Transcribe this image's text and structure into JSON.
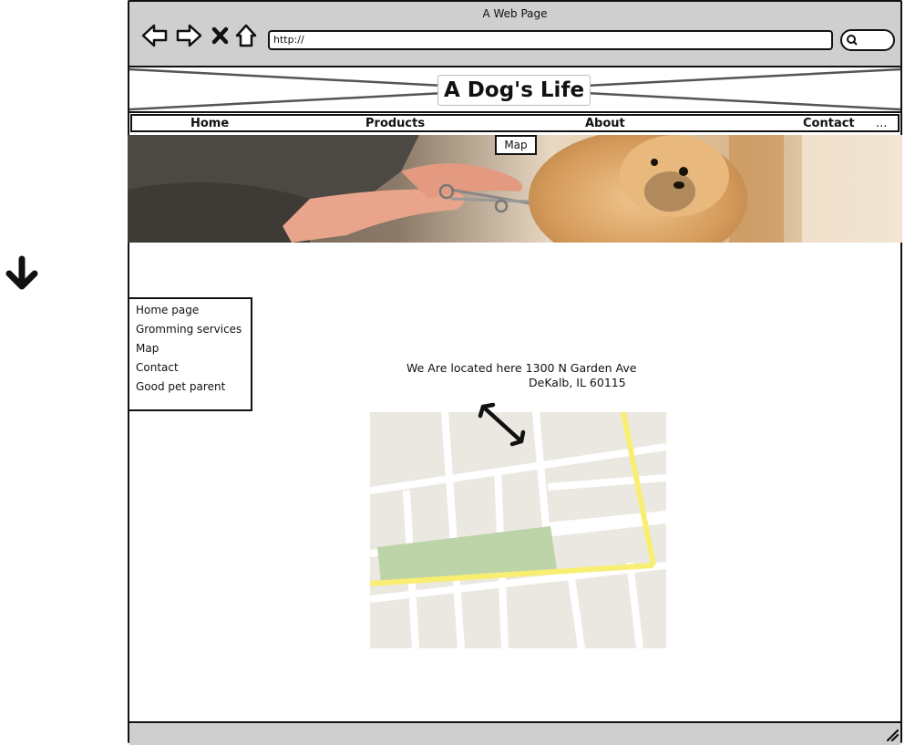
{
  "window": {
    "title": "A Web Page"
  },
  "browser": {
    "url": "http://",
    "nav_icons": [
      "back-icon",
      "forward-icon",
      "stop-icon",
      "home-icon"
    ],
    "search_icon": "search-icon"
  },
  "site": {
    "title": "A Dog's Life"
  },
  "navbar": {
    "items": [
      "Home",
      "Products",
      "About",
      "Contact"
    ],
    "more": "...",
    "dropdown": "Map"
  },
  "sidebar": {
    "items": [
      "Home page",
      "Gromming services",
      "Map",
      "Contact",
      "Good pet parent"
    ]
  },
  "content": {
    "location_line1": "We Are located here 1300 N Garden Ave",
    "location_line2": "DeKalb, IL 60115"
  },
  "colors": {
    "chrome_gray": "#cfcfcf",
    "map_bg": "#ebe8e1",
    "map_road": "#ffffff",
    "map_highway": "#f8ef72",
    "map_park": "#bcd4a8"
  }
}
